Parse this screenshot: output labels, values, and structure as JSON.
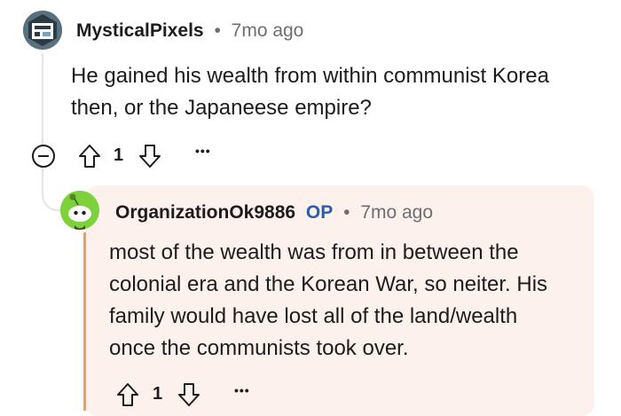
{
  "comment": {
    "username": "MysticalPixels",
    "separator": "•",
    "time": "7mo ago",
    "body_line1": "He gained his wealth from within communist Korea",
    "body_line2": "then, or the Japaneese empire?",
    "votes": "1",
    "more": "•••"
  },
  "reply": {
    "username": "OrganizationOk9886",
    "badge": "OP",
    "separator": "•",
    "time": "7mo ago",
    "body_line1": "most of the wealth was from in between the",
    "body_line2": "colonial era and the Korean War, so neiter. His",
    "body_line3": "family would have lost all of the land/wealth",
    "body_line4": "once the communists took over.",
    "votes": "1",
    "more": "•••"
  },
  "colors": {
    "op_card_bg": "#fcf1ec",
    "op_badge": "#2a5db0",
    "op_thread_line": "#d5a47f",
    "reply_avatar_bg": "#7dd23b"
  }
}
